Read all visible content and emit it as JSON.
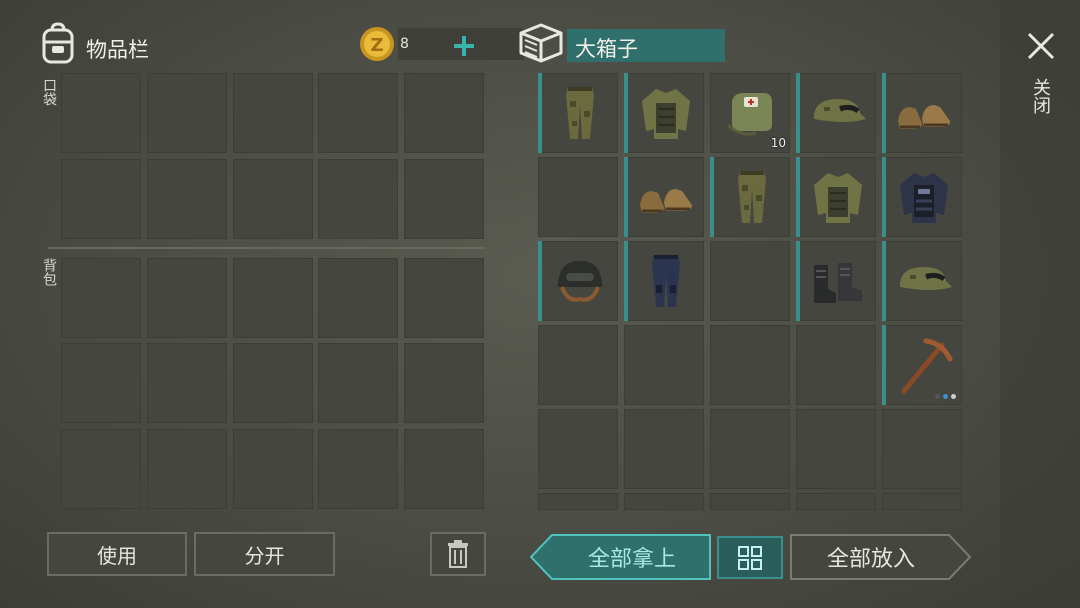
{
  "inventory": {
    "title": "物品栏",
    "coins": "8",
    "pocket_label": "口袋",
    "backpack_label": "背包"
  },
  "container": {
    "title": "大箱子"
  },
  "items": {
    "medkit_count": "10"
  },
  "buttons": {
    "use": "使用",
    "split": "分开",
    "take_all": "全部拿上",
    "put_all": "全部放入"
  },
  "close_label": "关闭",
  "colors": {
    "accent": "#3a8f8c",
    "slot": "#45463f",
    "background": "#4f5049"
  }
}
